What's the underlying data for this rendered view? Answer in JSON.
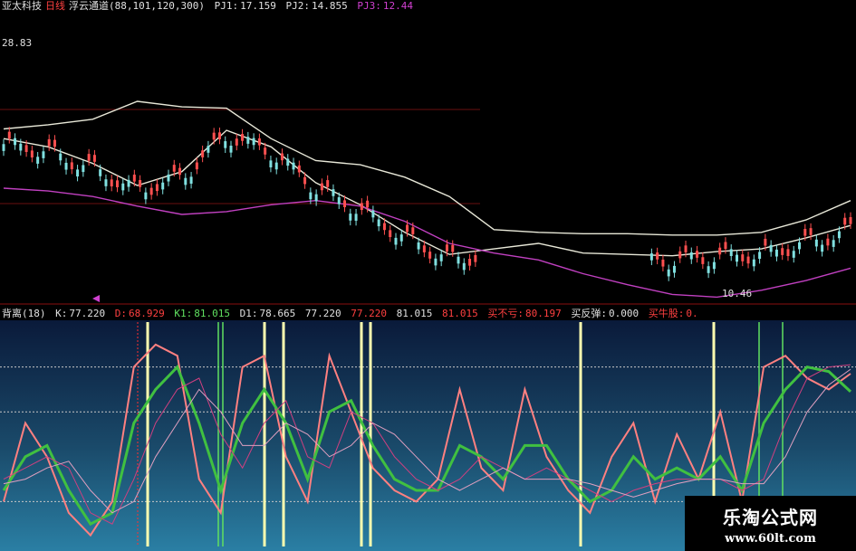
{
  "top_header": {
    "stock_name": "亚太科技",
    "period": "日线",
    "channel_label": "浮云通道(88,101,120,300)",
    "pj1_label": "PJ1:",
    "pj1_value": "17.159",
    "pj2_label": "PJ2:",
    "pj2_value": "14.855",
    "pj3_label": "PJ3:",
    "pj3_value": "12.44"
  },
  "price_high_label": "28.83",
  "price_low_label": "10.46",
  "indicator_header": {
    "name": "背离(18)",
    "k_label": "K:",
    "k_value": "77.220",
    "d_label": "D:",
    "d_value": "68.929",
    "k1_label": "K1:",
    "k1_value": "81.015",
    "d1_label": "D1:",
    "d1_value": "78.665",
    "v5": "77.220",
    "v6": "77.220",
    "v7": "81.015",
    "v8": "81.015",
    "buy_label": "买不亏:",
    "buy_value": "80.197",
    "rebound_label": "买反弹:",
    "rebound_value": "0.000",
    "bull_label": "买牛股:",
    "bull_value": "0."
  },
  "watermark": {
    "title": "乐淘公式网",
    "url": "www.60lt.com"
  },
  "colors": {
    "band": "#e8e8d8",
    "ma": "#c040c0",
    "up": "#ff5050",
    "down": "#80e0e0",
    "k_fast": "#ff8080",
    "d_slow": "#40c040",
    "signal_yellow": "#ffffb0",
    "signal_green": "#60e060"
  },
  "chart_data": [
    {
      "type": "line",
      "subtitle": "浮云通道(88,101,120,300)",
      "series": [
        {
          "name": "PJ1",
          "values": [
            22.5,
            22.8,
            23.2,
            24.5,
            24.1,
            24.0,
            21.8,
            20.2,
            19.9,
            19.0,
            17.6,
            15.2,
            15.0,
            14.9,
            14.9,
            14.8,
            14.8,
            15.0,
            15.9,
            17.3
          ]
        },
        {
          "name": "PJ2",
          "values": [
            21.8,
            21.2,
            20.0,
            18.4,
            19.4,
            22.4,
            21.2,
            18.6,
            17.0,
            15.0,
            13.4,
            13.8,
            14.2,
            13.5,
            13.4,
            13.3,
            13.6,
            13.8,
            14.6,
            15.5
          ]
        },
        {
          "name": "PJ3",
          "values": [
            18.2,
            18.0,
            17.6,
            16.9,
            16.3,
            16.5,
            17.0,
            17.3,
            16.9,
            15.8,
            14.2,
            13.5,
            13.0,
            12.0,
            11.2,
            10.5,
            10.3,
            10.8,
            11.5,
            12.4
          ]
        }
      ],
      "y_marks": [
        "28.83",
        "10.46"
      ]
    },
    {
      "type": "line",
      "subtitle": "背离(18)",
      "ylim": [
        0,
        100
      ],
      "series": [
        {
          "name": "K",
          "values": [
            20,
            55,
            40,
            15,
            5,
            20,
            80,
            90,
            85,
            30,
            15,
            80,
            85,
            40,
            20,
            85,
            60,
            35,
            25,
            20,
            30,
            70,
            35,
            25,
            70,
            40,
            25,
            15,
            40,
            55,
            20,
            50,
            30,
            60,
            20,
            80,
            85,
            75,
            70,
            77
          ]
        },
        {
          "name": "D",
          "values": [
            25,
            40,
            45,
            25,
            10,
            15,
            55,
            70,
            80,
            55,
            25,
            55,
            70,
            55,
            30,
            60,
            65,
            45,
            30,
            25,
            25,
            45,
            40,
            30,
            45,
            45,
            30,
            20,
            25,
            40,
            30,
            35,
            30,
            40,
            25,
            55,
            70,
            80,
            78,
            69
          ]
        },
        {
          "name": "K1",
          "values": [
            30,
            35,
            40,
            35,
            15,
            10,
            30,
            55,
            70,
            75,
            50,
            35,
            55,
            65,
            40,
            35,
            60,
            55,
            40,
            30,
            25,
            30,
            40,
            35,
            30,
            35,
            30,
            25,
            20,
            25,
            28,
            30,
            30,
            30,
            25,
            30,
            55,
            75,
            80,
            81
          ]
        },
        {
          "name": "D1",
          "values": [
            28,
            30,
            35,
            38,
            25,
            15,
            20,
            40,
            55,
            70,
            60,
            45,
            45,
            55,
            50,
            40,
            45,
            55,
            50,
            40,
            30,
            25,
            30,
            35,
            30,
            30,
            30,
            28,
            25,
            22,
            25,
            28,
            30,
            30,
            28,
            28,
            40,
            60,
            72,
            79
          ]
        }
      ]
    }
  ]
}
